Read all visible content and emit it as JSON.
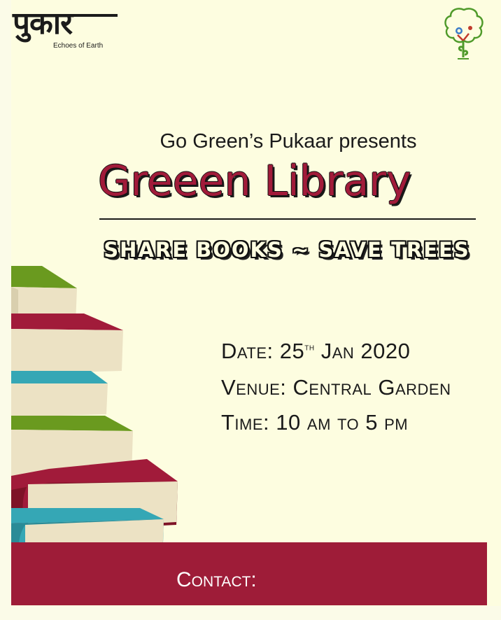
{
  "logo": {
    "word": "पुकार",
    "subtitle": "Echoes of Earth"
  },
  "poster": {
    "presents": "Go Green’s Pukaar presents",
    "title": "Greeen Library",
    "tagline": "SHARE BOOKS ~ SAVE TREES"
  },
  "details": {
    "date_label": "Date:",
    "date_day": "25",
    "date_suffix": "th",
    "date_rest": "Jan 2020",
    "venue_label": "Venue:",
    "venue_value": "Central Garden",
    "time_label": "Time:",
    "time_value": "10 am to 5 pm"
  },
  "contact": {
    "label": "Contact:"
  },
  "colors": {
    "background": "#fdfde0",
    "accent": "#9e1c38",
    "book_green": "#6a9a1f",
    "book_red": "#a11b3a",
    "book_teal": "#35a7b5"
  }
}
